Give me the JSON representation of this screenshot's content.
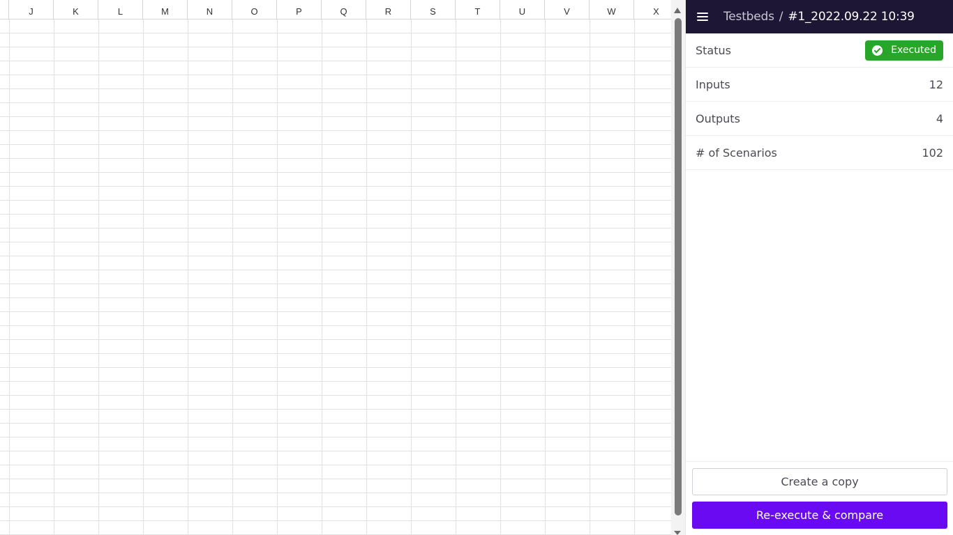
{
  "sheet": {
    "columns": [
      "J",
      "K",
      "L",
      "M",
      "N",
      "O",
      "P",
      "Q",
      "R",
      "S",
      "T",
      "U",
      "V",
      "W",
      "X"
    ]
  },
  "panel": {
    "breadcrumb": {
      "root": "Testbeds",
      "separator": "/",
      "current": "#1_2022.09.22 10:39"
    },
    "status": {
      "label": "Status",
      "value": "Executed",
      "color": "#27a62a"
    },
    "inputs": {
      "label": "Inputs",
      "value": "12"
    },
    "outputs": {
      "label": "Outputs",
      "value": "4"
    },
    "scenarios": {
      "label": "# of Scenarios",
      "value": "102"
    },
    "actions": {
      "copy_label": "Create a copy",
      "reexecute_label": "Re-execute & compare",
      "accent": "#6a0af2"
    },
    "header_bg": "#1d1635"
  }
}
